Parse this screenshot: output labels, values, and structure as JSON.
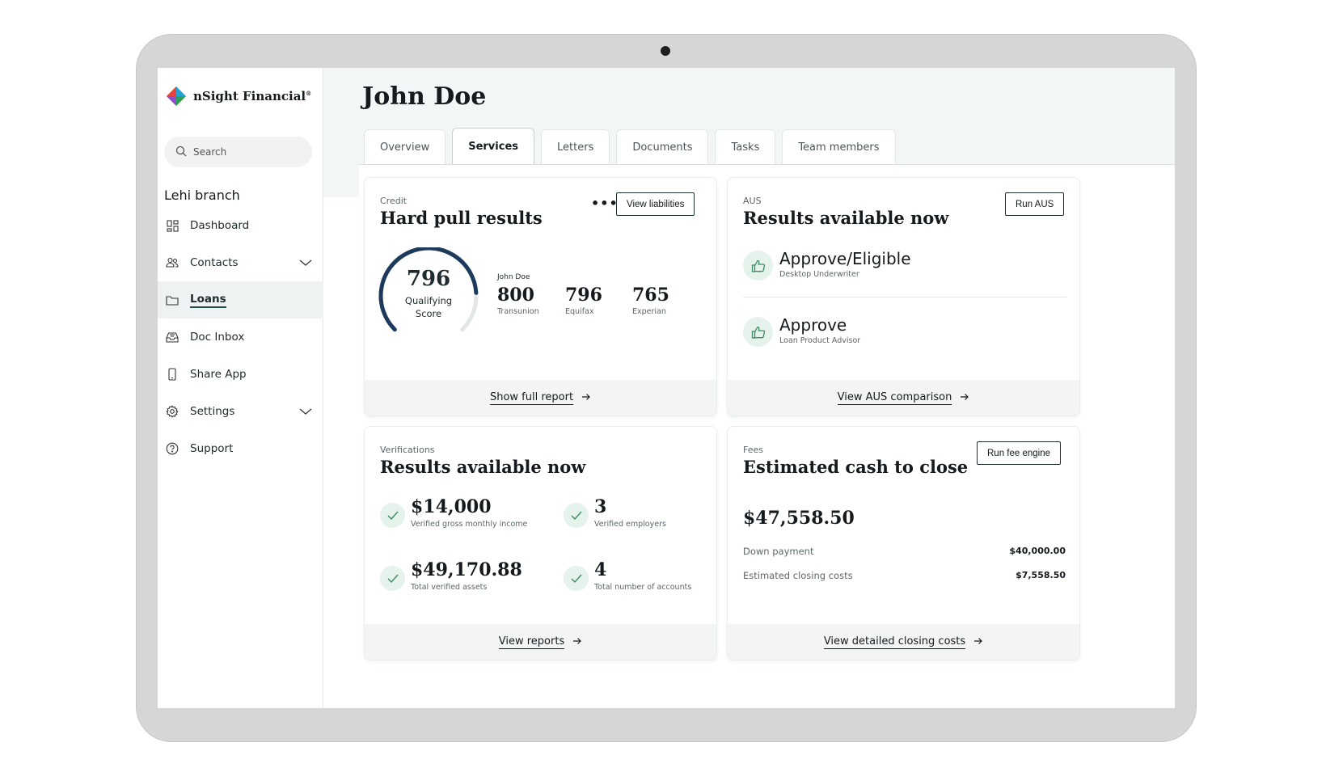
{
  "brand": {
    "name": "nSight Financial",
    "mark": "®"
  },
  "sidebar": {
    "search_placeholder": "Search",
    "branch": "Lehi branch",
    "items": [
      {
        "label": "Dashboard",
        "icon": "dashboard-icon"
      },
      {
        "label": "Contacts",
        "icon": "contacts-icon",
        "expandable": true
      },
      {
        "label": "Loans",
        "icon": "folder-icon",
        "active": true
      },
      {
        "label": "Doc Inbox",
        "icon": "inbox-icon"
      },
      {
        "label": "Share App",
        "icon": "phone-icon"
      },
      {
        "label": "Settings",
        "icon": "gear-icon",
        "expandable": true
      },
      {
        "label": "Support",
        "icon": "help-icon"
      }
    ]
  },
  "header": {
    "title": "John Doe",
    "tabs": [
      "Overview",
      "Services",
      "Letters",
      "Documents",
      "Tasks",
      "Team members"
    ],
    "active_tab": "Services"
  },
  "credit": {
    "eyebrow": "Credit",
    "title": "Hard pull results",
    "button": "View liabilities",
    "score": "796",
    "score_label_1": "Qualifying",
    "score_label_2": "Score",
    "gauge_fraction": 0.82,
    "borrower": "John Doe",
    "bureaus": [
      {
        "score": "800",
        "name": "Transunion"
      },
      {
        "score": "796",
        "name": "Equifax"
      },
      {
        "score": "765",
        "name": "Experian"
      }
    ],
    "footer": "Show full report"
  },
  "aus": {
    "eyebrow": "AUS",
    "title": "Results available now",
    "button": "Run AUS",
    "results": [
      {
        "decision": "Approve/Eligible",
        "source": "Desktop Underwriter"
      },
      {
        "decision": "Approve",
        "source": "Loan Product Advisor"
      }
    ],
    "footer": "View AUS comparison"
  },
  "verifications": {
    "eyebrow": "Verifications",
    "title": "Results available now",
    "items": [
      {
        "value": "$14,000",
        "label": "Verified gross monthly income"
      },
      {
        "value": "3",
        "label": "Verified employers"
      },
      {
        "value": "$49,170.88",
        "label": "Total verified assets"
      },
      {
        "value": "4",
        "label": "Total number of accounts"
      }
    ],
    "footer": "View reports"
  },
  "fees": {
    "eyebrow": "Fees",
    "title": "Estimated cash to close",
    "button": "Run fee engine",
    "total": "$47,558.50",
    "rows": [
      {
        "label": "Down payment",
        "amount": "$40,000.00"
      },
      {
        "label": "Estimated closing costs",
        "amount": "$7,558.50"
      }
    ],
    "footer": "View detailed closing costs"
  },
  "colors": {
    "accent": "#1f4e4a",
    "gauge": "#1d3a5c",
    "success_bg": "#e6f2ec",
    "success": "#3d8b63"
  }
}
